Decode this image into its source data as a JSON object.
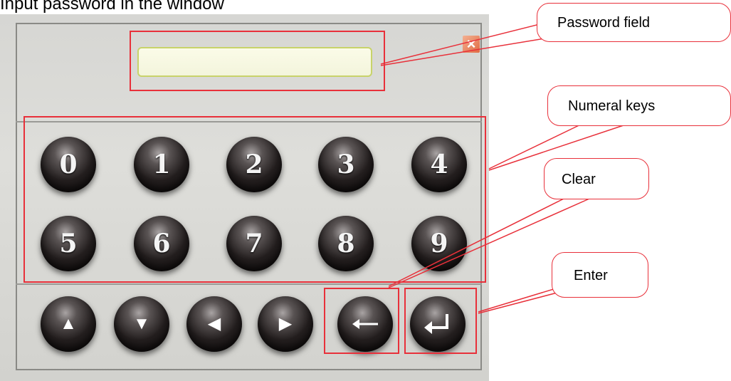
{
  "heading": "Input password in the window",
  "password_field": {
    "value": ""
  },
  "numeral_keys": [
    "0",
    "1",
    "2",
    "3",
    "4",
    "5",
    "6",
    "7",
    "8",
    "9"
  ],
  "nav_keys": [
    {
      "name": "up-arrow-key",
      "icon": "triangle-up-icon",
      "glyph": "▲"
    },
    {
      "name": "down-arrow-key",
      "icon": "triangle-down-icon",
      "glyph": "▼"
    },
    {
      "name": "left-arrow-key",
      "icon": "triangle-left-icon",
      "glyph": "◀"
    },
    {
      "name": "right-arrow-key",
      "icon": "triangle-right-icon",
      "glyph": "▶"
    }
  ],
  "callouts": {
    "password_field": "Password field",
    "numeral_keys": "Numeral keys",
    "clear": "Clear",
    "enter": "Enter"
  },
  "colors": {
    "annotation_red": "#e8303a",
    "field_border": "#c8d36a",
    "close_orange": "#e06b43"
  }
}
